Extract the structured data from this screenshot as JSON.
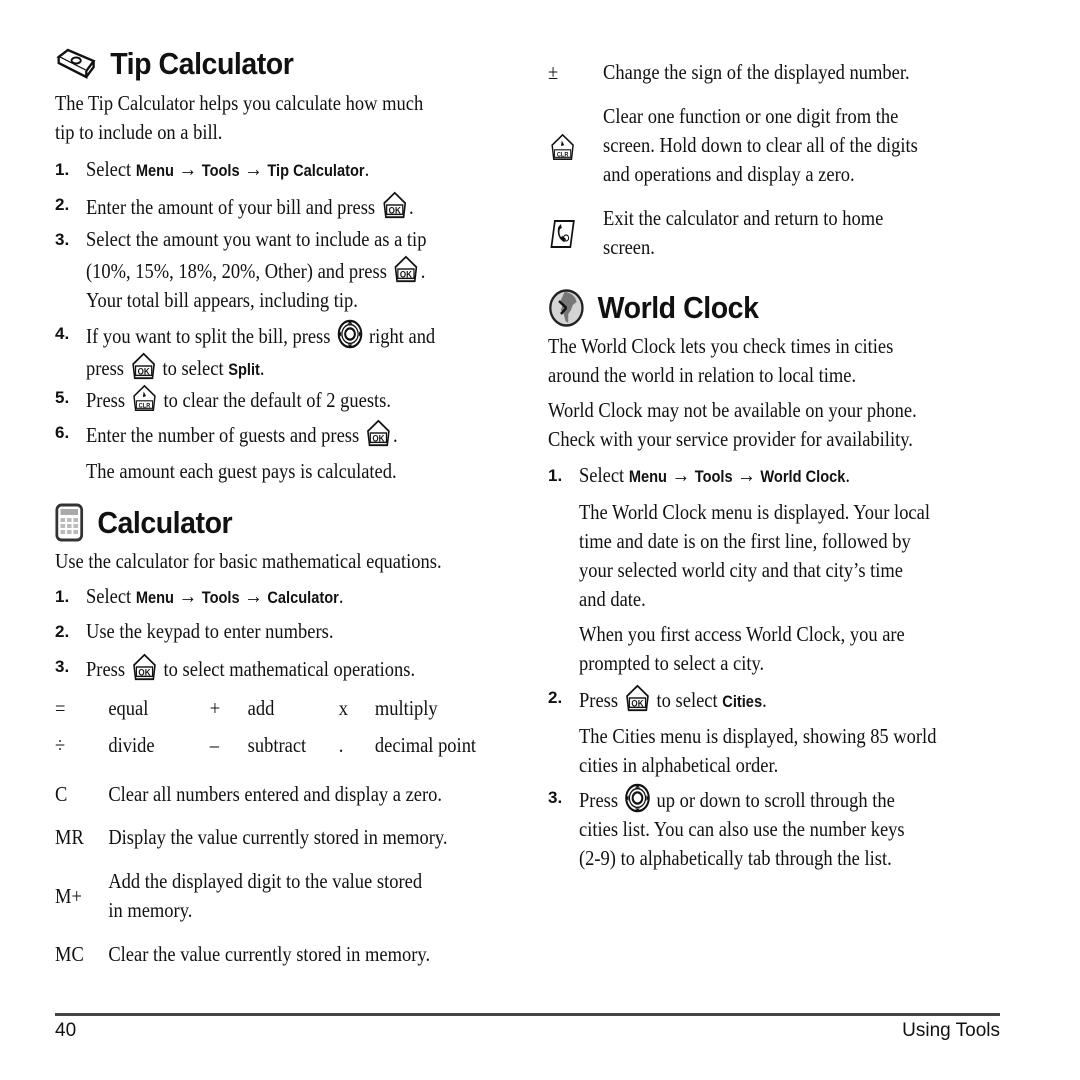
{
  "tip_calculator": {
    "title": "Tip Calculator",
    "icon": "money-bill-icon",
    "intro_1": "The Tip Calculator helps you calculate how much",
    "intro_2": "tip to include on a bill.",
    "steps": [
      {
        "num": "1.",
        "pre": "Select ",
        "menu": "Menu",
        "arrow1": " → ",
        "tools": "Tools",
        "arrow2": " → ",
        "target": "Tip Calculator",
        "post": "."
      },
      {
        "num": "2.",
        "text": "Enter the amount of your bill and press",
        "post": "."
      },
      {
        "num": "3.",
        "line1": "Select the amount you want to include as a tip",
        "line2": "(10%, 15%, 18%, 20%, Other) and press",
        "line2_post": ".",
        "line3": "Your total bill appears, including tip."
      },
      {
        "num": "4.",
        "line1_pre": "If you want to split the bill, press",
        "line1_post": "right and",
        "line2_pre": "press",
        "line2_mid": "to select ",
        "line2_bold": "Split",
        "line2_post": "."
      },
      {
        "num": "5.",
        "pre": "Press",
        "post": "to clear the default of 2 guests."
      },
      {
        "num": "6.",
        "text": "Enter the number of guests and press",
        "post": ".",
        "note": "The amount each guest pays is calculated."
      }
    ]
  },
  "calculator": {
    "title": "Calculator",
    "icon": "calculator-icon",
    "intro": "Use the calculator for basic mathematical equations.",
    "steps": [
      {
        "num": "1.",
        "pre": "Select ",
        "menu": "Menu",
        "arrow1": " → ",
        "tools": "Tools",
        "arrow2": " → ",
        "target": "Calculator",
        "post": "."
      },
      {
        "num": "2.",
        "text": "Use the keypad to enter numbers."
      },
      {
        "num": "3.",
        "pre": "Press",
        "post": "to select mathematical operations."
      }
    ],
    "operators": [
      {
        "symbol": "=",
        "label": "equal"
      },
      {
        "symbol": "+",
        "label": "add"
      },
      {
        "symbol": "x",
        "label": "multiply"
      },
      {
        "symbol": "÷",
        "label": "divide"
      },
      {
        "symbol": "–",
        "label": "subtract"
      },
      {
        "symbol": ".",
        "label": "decimal point"
      }
    ],
    "functions": [
      {
        "key": "C",
        "desc": "Clear all numbers entered and display a zero."
      },
      {
        "key": "MR",
        "desc": "Display the value currently stored in memory."
      },
      {
        "key": "M+",
        "desc_1": "Add the displayed digit to the value stored",
        "desc_2": "in memory."
      },
      {
        "key": "MC",
        "desc": "Clear the value currently stored in memory."
      }
    ],
    "more_functions": [
      {
        "key": "±",
        "desc": "Change the sign of the displayed number."
      },
      {
        "key_icon": "clr-key-icon",
        "desc_1": "Clear one function or one digit from the",
        "desc_2": "screen. Hold down to clear all of the digits",
        "desc_3": "and operations and display a zero."
      },
      {
        "key_icon": "end-key-icon",
        "desc_1": "Exit the calculator and return to home",
        "desc_2": "screen."
      }
    ]
  },
  "world_clock": {
    "title": "World Clock",
    "icon": "world-clock-icon",
    "intro_1": "The World Clock lets you check times in cities",
    "intro_2": "around the world in relation to local time.",
    "note_1": "World Clock may not be available on your phone.",
    "note_2": "Check with your service provider for availability.",
    "steps": [
      {
        "num": "1.",
        "pre": "Select ",
        "menu": "Menu",
        "arrow1": " → ",
        "tools": "Tools",
        "arrow2": " → ",
        "target": "World Clock",
        "post": ".",
        "desc": [
          "The World Clock menu is displayed. Your local",
          "time and date is on the first line, followed by",
          "your selected world city and that city’s time",
          "and date."
        ],
        "desc2": [
          "When you first access World Clock, you are",
          "prompted to select a city."
        ]
      },
      {
        "num": "2.",
        "pre": "Press",
        "mid": "to select ",
        "bold": "Cities",
        "post": ".",
        "desc": [
          "The Cities menu is displayed, showing 85 world",
          "cities in alphabetical order."
        ]
      },
      {
        "num": "3.",
        "pre": "Press",
        "post": "up or down to scroll through the",
        "line2": "cities list. You can also use the number keys",
        "line3": "(2-9) to alphabetically tab through the list."
      }
    ]
  },
  "footer": {
    "page_number": "40",
    "section": "Using Tools"
  }
}
